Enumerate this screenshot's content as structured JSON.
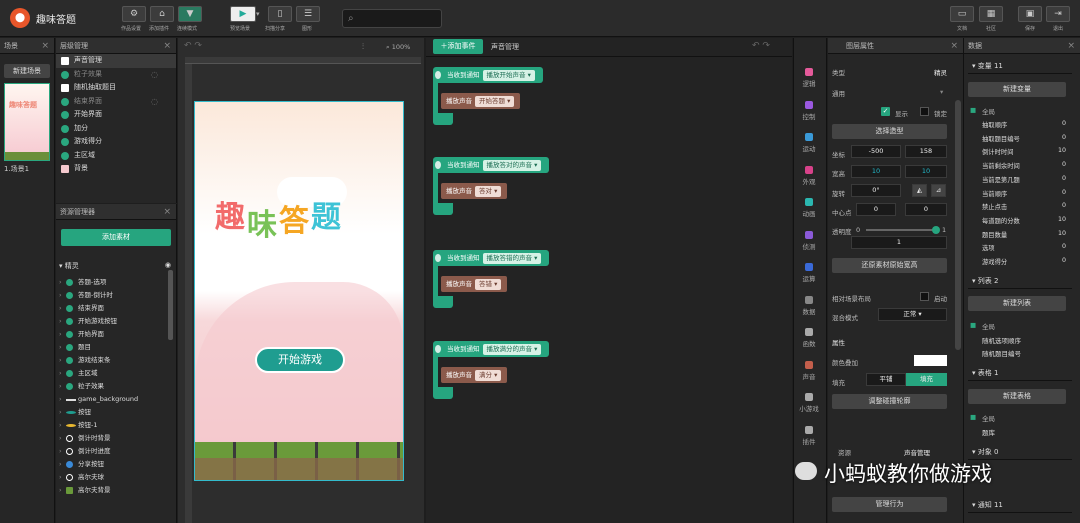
{
  "app": {
    "title": "趣味答题",
    "logo_icon": "logo-icon"
  },
  "toolbar": {
    "left": [
      {
        "label": "作品设置",
        "icon": "settings-icon"
      },
      {
        "label": "添加插件",
        "icon": "home-icon"
      },
      {
        "label": "连续模式",
        "icon": "mode-icon"
      }
    ],
    "mid": [
      {
        "label": "预览场景",
        "icon": "play-icon"
      },
      {
        "label": "扫描分享",
        "icon": "phone-icon"
      },
      {
        "label": "图形",
        "icon": "list-icon"
      }
    ],
    "right": [
      {
        "label": "文档",
        "icon": "book-icon"
      },
      {
        "label": "社区",
        "icon": "community-icon"
      },
      {
        "label": "保存",
        "icon": "save-icon"
      },
      {
        "label": "退出",
        "icon": "exit-icon"
      }
    ],
    "search_placeholder": ""
  },
  "scene_panel": {
    "title": "场景",
    "new_button": "新建场景",
    "thumb_label": "1.场景1",
    "thumb_title": "趣味答题"
  },
  "layer_panel": {
    "title": "层级管理",
    "items": [
      "声音管理",
      "粒子效果",
      "随机抽取题目",
      "结束界面",
      "开始界面",
      "加分",
      "游戏得分",
      "主区域",
      "背景"
    ]
  },
  "resource_panel": {
    "title": "资源管理器",
    "add_button": "添加素材",
    "group": "精灵",
    "items": [
      "答题-选项",
      "答题-倒计时",
      "结束界面",
      "开始游戏按钮",
      "开始界面",
      "题目",
      "游戏结束条",
      "主区域",
      "粒子效果",
      "game_background",
      "按钮",
      "按钮-1",
      "倒计时背景",
      "倒计时进度",
      "分享按钮",
      "高尔夫球",
      "高尔夫背景"
    ]
  },
  "stage": {
    "zoom": "100%",
    "title_chars": [
      "趣",
      "味",
      "答",
      "题"
    ],
    "start_button": "开始游戏"
  },
  "event_panel": {
    "add_button": "添加事件",
    "tab": "声音管理",
    "blocks": [
      {
        "trigger": "当收到通知",
        "notice": "播放开始声音",
        "action": "播放声音",
        "sound": "开始答题"
      },
      {
        "trigger": "当收到通知",
        "notice": "播放答对的声音",
        "action": "播放声音",
        "sound": "答对"
      },
      {
        "trigger": "当收到通知",
        "notice": "播放答错的声音",
        "action": "播放声音",
        "sound": "答错"
      },
      {
        "trigger": "当收到通知",
        "notice": "播放满分的声音",
        "action": "播放声音",
        "sound": "满分"
      }
    ]
  },
  "categories": [
    "逻辑",
    "控制",
    "运动",
    "外观",
    "动画",
    "侦测",
    "运算",
    "数据",
    "函数",
    "声音",
    "小游戏",
    "插件"
  ],
  "props": {
    "title": "图层属性",
    "type_label": "类型",
    "type_value": "精灵",
    "general": "通用",
    "show": "显示",
    "lock": "锁定",
    "choose_shape": "选择造型",
    "coord_label": "坐标",
    "x": "-500",
    "y": "158",
    "size_label": "宽高",
    "w": "10",
    "h": "10",
    "rotate_label": "旋转",
    "rotate": "0°",
    "center_label": "中心点",
    "cx": "0",
    "cy": "0",
    "alpha_label": "透明度",
    "alpha_min": "0",
    "alpha_max": "1",
    "alpha_value": "1",
    "restore_button": "还原素材原始宽高",
    "relative_label": "相对场景布局",
    "enable_label": "启动",
    "blend_label": "混合模式",
    "blend_value": "正常",
    "attr_title": "属性",
    "color_label": "颜色叠加",
    "fill_label": "填充",
    "fill_opt1": "平铺",
    "fill_opt2": "填充",
    "collision_button": "调整碰撞轮廓",
    "res_label": "资源",
    "res_value": "声音管理",
    "manage_button": "管理行为"
  },
  "data_panel": {
    "title": "数据",
    "var_section": "变量 11",
    "new_var": "新建变量",
    "scope": "全局",
    "vars": [
      [
        "抽取顺序",
        "0"
      ],
      [
        "抽取题目编号",
        "0"
      ],
      [
        "倒计时时间",
        "10"
      ],
      [
        "当前剩余时间",
        "0"
      ],
      [
        "当前是第几题",
        "0"
      ],
      [
        "当前顺序",
        "0"
      ],
      [
        "禁止点击",
        "0"
      ],
      [
        "每道题的分数",
        "10"
      ],
      [
        "题目数量",
        "10"
      ],
      [
        "选项",
        "0"
      ],
      [
        "游戏得分",
        "0"
      ]
    ],
    "list_section": "列表 2",
    "new_list": "新建列表",
    "lists": [
      "随机选项顺序",
      "随机题目编号"
    ],
    "table_section": "表格 1",
    "new_table": "新建表格",
    "tables": [
      "题库"
    ],
    "obj_section": "对象 0",
    "notice_section": "通知 11"
  },
  "watermark": "小蚂蚁教你做游戏"
}
